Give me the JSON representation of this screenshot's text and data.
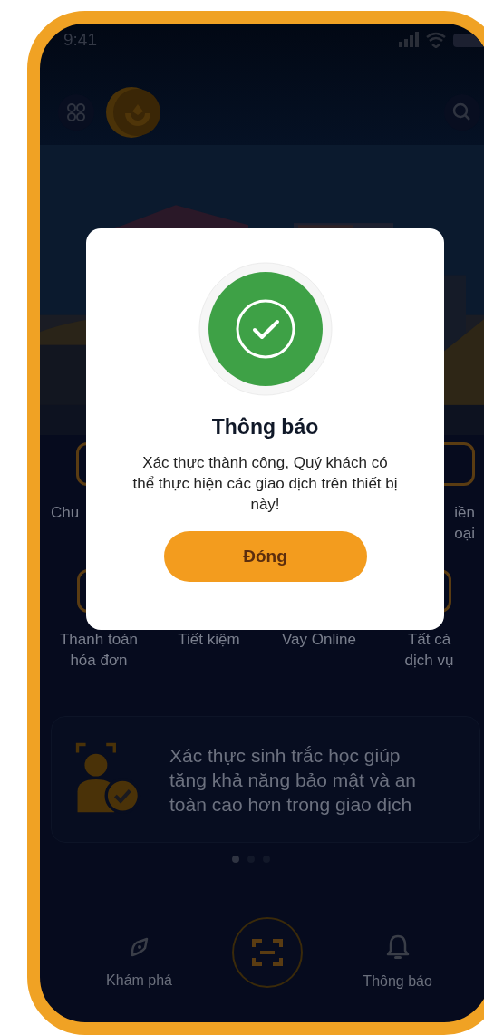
{
  "status_bar": {
    "time": "9:41"
  },
  "services_row_1": [
    {
      "kind": "tile",
      "lines": [
        "Chu"
      ]
    },
    {
      "kind": "tile",
      "lines": [
        "iền",
        "oại"
      ]
    }
  ],
  "services_row_2": [
    {
      "kind": "tile",
      "lines": [
        "Thanh toán",
        "hóa đơn"
      ]
    },
    {
      "kind": "label",
      "lines": [
        "Tiết kiệm"
      ]
    },
    {
      "kind": "label",
      "lines": [
        "Vay Online"
      ]
    },
    {
      "kind": "tile",
      "lines": [
        "Tất cả",
        "dịch vụ"
      ]
    }
  ],
  "banner": {
    "text": "Xác thực sinh trắc học giúp tăng khả năng bảo mật và an toàn cao hơn trong giao dịch"
  },
  "carousel_dots": [
    {
      "selected": true
    },
    {
      "selected": false
    },
    {
      "selected": false
    }
  ],
  "bottom_nav": [
    {
      "kind": "explore",
      "label": "Khám phá"
    },
    {
      "kind": "scan"
    },
    {
      "kind": "bell",
      "label": "Thông báo"
    }
  ],
  "dialog": {
    "title": "Thông báo",
    "message": "Xác thực thành công, Quý khách có thể thực hiện các giao dịch trên thiết bị này!",
    "button": "Đóng"
  }
}
